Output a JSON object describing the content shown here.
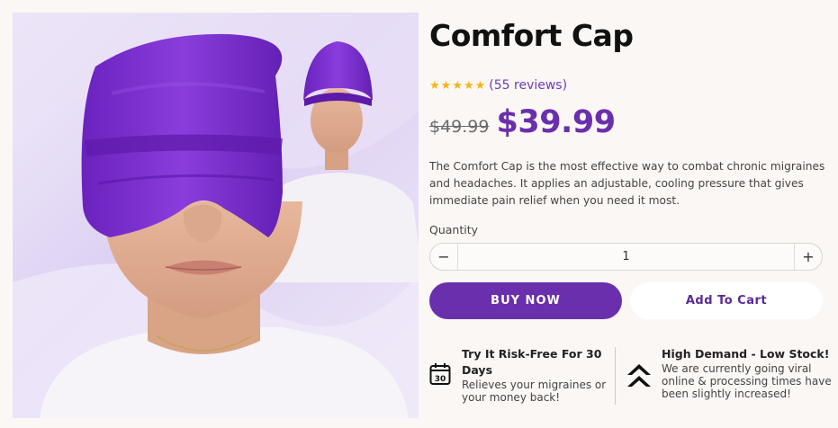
{
  "product": {
    "title": "Comfort Cap",
    "rating_stars": 5,
    "reviews": "(55 reviews)",
    "old_price": "$49.99",
    "price": "$39.99",
    "description": "The Comfort Cap is the most effective way to combat chronic migraines and headaches. It applies an adjustable, cooling pressure that gives immediate pain relief when you need it most.",
    "image_alt": "Woman wearing purple Comfort Cap over eyes, inset of cap worn as beanie"
  },
  "quantity": {
    "label": "Quantity",
    "value": "1",
    "minus": "−",
    "plus": "+"
  },
  "actions": {
    "buy_now": "BUY NOW",
    "add_to_cart": "Add To Cart"
  },
  "features": [
    {
      "icon": "calendar-30-icon",
      "icon_text": "30",
      "title": "Try It Risk-Free For 30 Days",
      "body": "Relieves your migraines or your money back!"
    },
    {
      "icon": "double-chevron-up-icon",
      "title": "High Demand - Low Stock!",
      "body": "We are currently going viral online & processing times have been slightly increased!"
    }
  ],
  "colors": {
    "accent": "#6a2fad",
    "cap": "#7a2fd0",
    "star": "#f5b41a",
    "background": "#fbf7f4"
  }
}
